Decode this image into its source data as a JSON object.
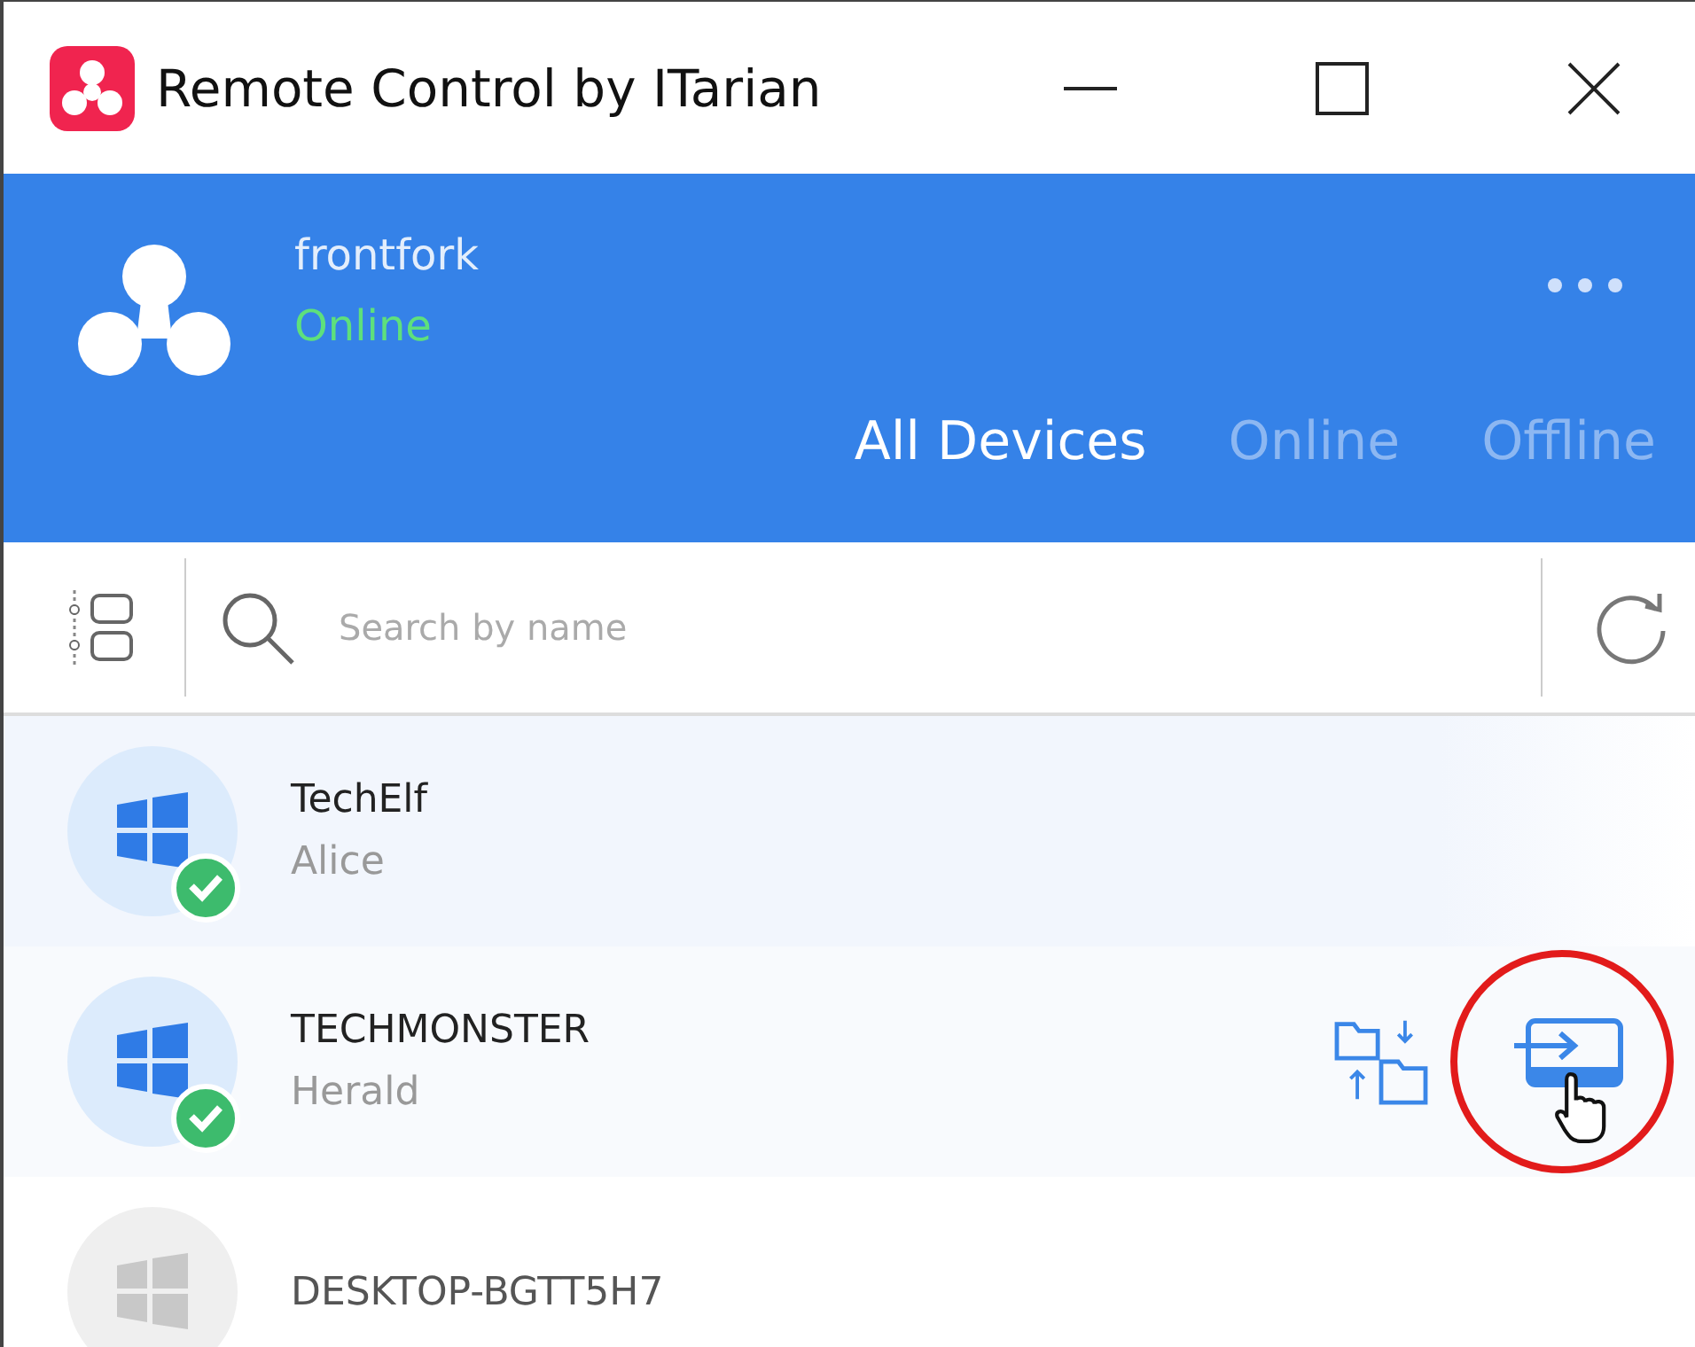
{
  "window": {
    "title": "Remote Control by ITarian"
  },
  "account": {
    "name": "frontfork",
    "status": "Online"
  },
  "tabs": [
    {
      "label": "All Devices",
      "selected": true
    },
    {
      "label": "Online",
      "selected": false
    },
    {
      "label": "Offline",
      "selected": false
    }
  ],
  "search": {
    "placeholder": "Search by name"
  },
  "devices": [
    {
      "name": "TechElf",
      "owner": "Alice",
      "online": true,
      "actions_shown": false
    },
    {
      "name": "TECHMONSTER",
      "owner": "Herald",
      "online": true,
      "actions_shown": true,
      "highlighted_action": true
    },
    {
      "name": "DESKTOP-BGTT5H7",
      "online": false,
      "actions_shown": false
    }
  ]
}
